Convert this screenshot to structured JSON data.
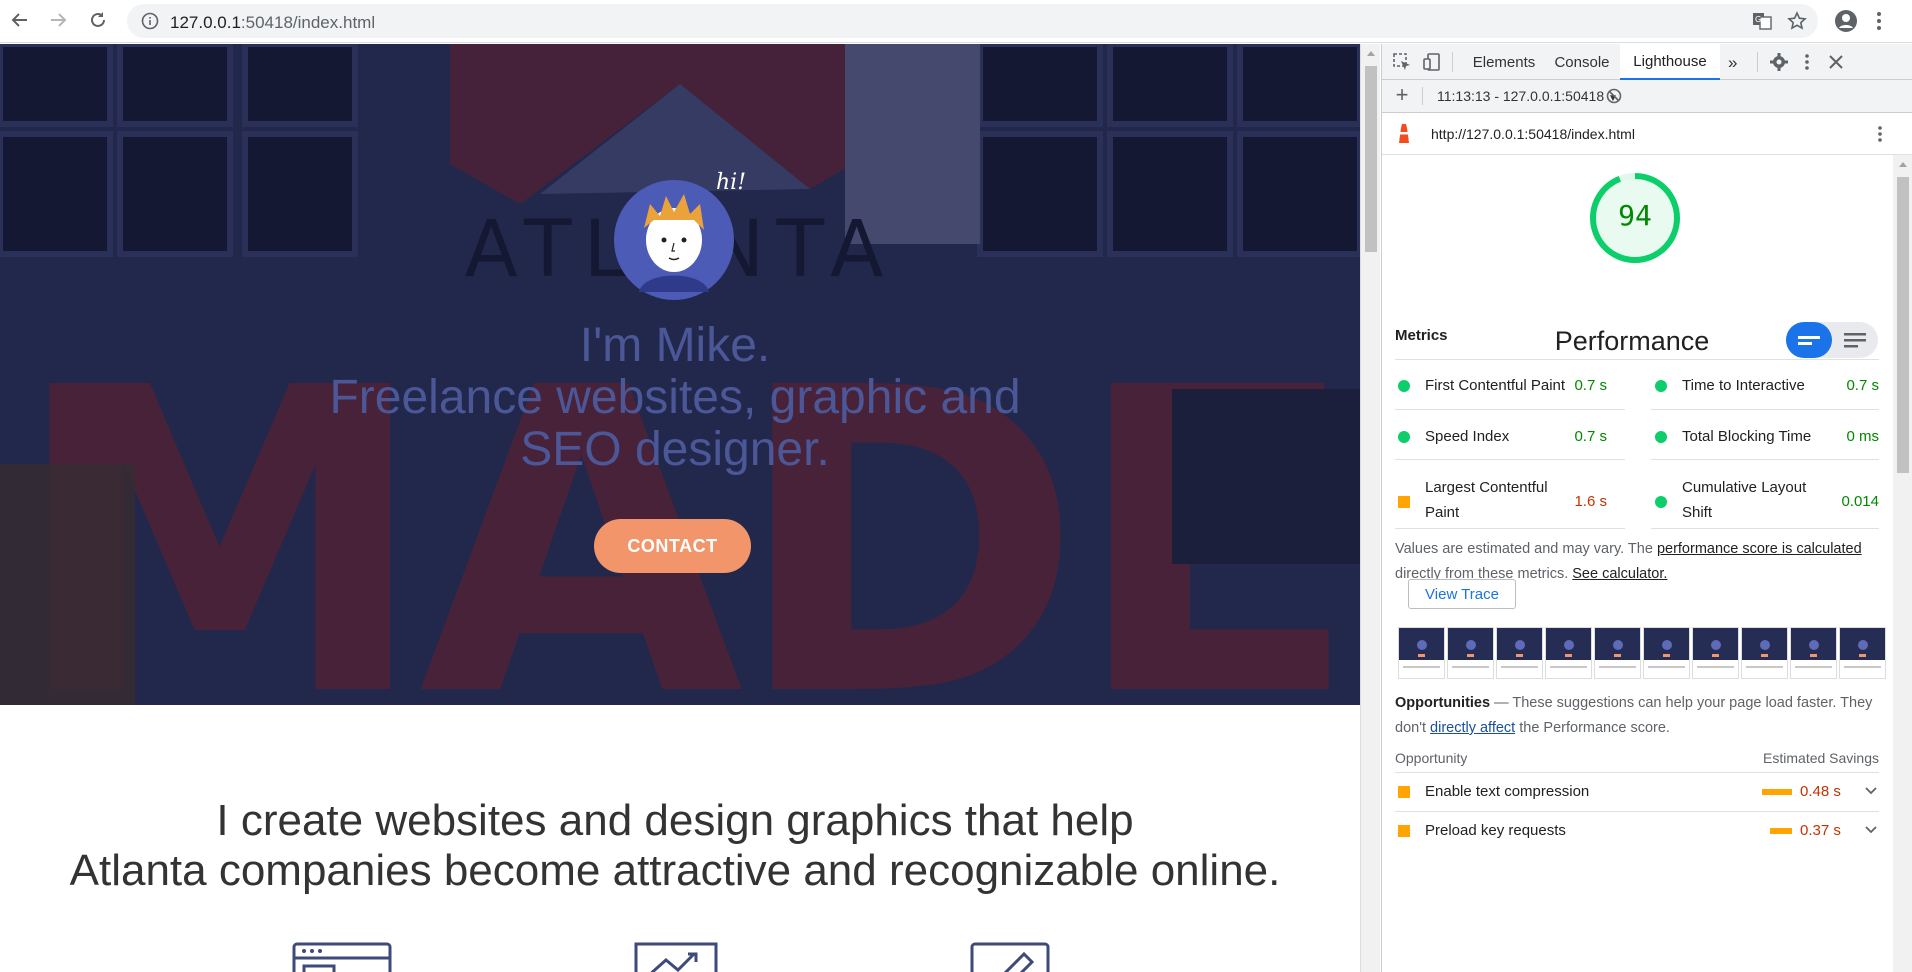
{
  "browser": {
    "url_host": "127.0.0.1",
    "url_rest": ":50418/index.html",
    "icons": [
      "back-arrow-icon",
      "forward-arrow-icon",
      "reload-icon",
      "info-icon",
      "translate-icon",
      "star-icon",
      "account-icon",
      "more-vert-icon"
    ]
  },
  "hero": {
    "hi_text": "hi!",
    "headline_line1": "I'm Mike.",
    "headline_line2": "Freelance websites, graphic and",
    "headline_line3": "SEO designer.",
    "contact_label": "CONTACT",
    "bg_word_top": "ATLANTA",
    "bg_word_bottom": "MADE"
  },
  "about": {
    "line1": "I create websites and design graphics that help",
    "line2": "Atlanta companies become attractive and recognizable online."
  },
  "devtools": {
    "tabs": [
      "Elements",
      "Console",
      "Lighthouse"
    ],
    "active_tab": "Lighthouse",
    "session": "11:13:13 - 127.0.0.1:50418",
    "report_url": "http://127.0.0.1:50418/index.html",
    "score": "94",
    "category": "Performance",
    "metrics_title": "Metrics",
    "metrics": [
      {
        "name": "First Contentful Paint",
        "value": "0.7 s",
        "status": "pass"
      },
      {
        "name": "Time to Interactive",
        "value": "0.7 s",
        "status": "pass"
      },
      {
        "name": "Speed Index",
        "value": "0.7 s",
        "status": "pass"
      },
      {
        "name": "Total Blocking Time",
        "value": "0 ms",
        "status": "pass"
      },
      {
        "name": "Largest Contentful Paint",
        "value": "1.6 s",
        "status": "average"
      },
      {
        "name": "Cumulative Layout Shift",
        "value": "0.014",
        "status": "pass"
      }
    ],
    "note_pre": "Values are estimated and may vary. The ",
    "note_link1": "performance score is calculated",
    "note_mid": " directly from these metrics. ",
    "note_link2": "See calculator.",
    "view_trace": "View Trace",
    "opps_title": "Opportunities",
    "opps_desc_pre": " — These suggestions can help your page load faster. They don't ",
    "opps_desc_link": "directly affect",
    "opps_desc_post": " the Performance score.",
    "opp_col": "Opportunity",
    "savings_col": "Estimated Savings",
    "opportunities": [
      {
        "name": "Enable text compression",
        "savings": "0.48 s"
      },
      {
        "name": "Preload key requests",
        "savings": "0.37 s"
      }
    ],
    "colors": {
      "pass": "#0cce6b",
      "average": "#ffa400",
      "pass_text": "#008800",
      "average_text": "#c33300",
      "accent": "#1a73e8"
    }
  }
}
